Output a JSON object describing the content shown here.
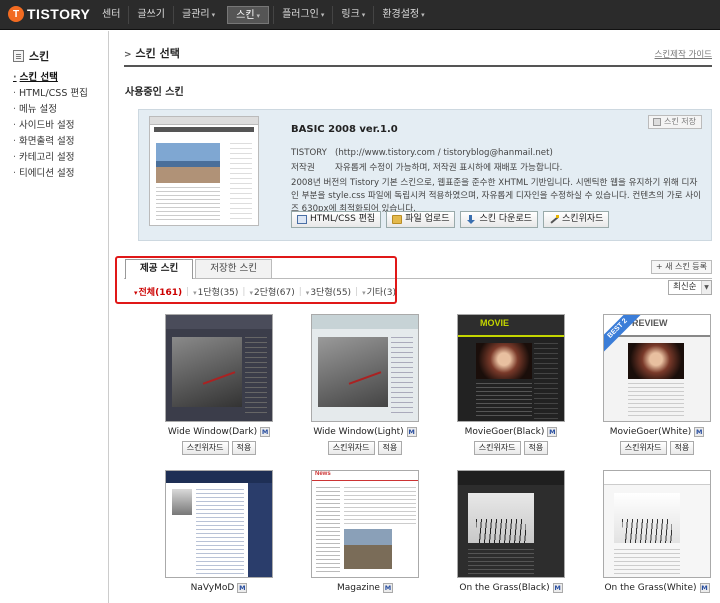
{
  "brand": {
    "logo_mark": "T",
    "logo_text": "TISTORY"
  },
  "nav": {
    "items": [
      {
        "label": "센터"
      },
      {
        "label": "글쓰기"
      },
      {
        "label": "글관리",
        "caret": "▾"
      },
      {
        "label": "스킨",
        "caret": "▾",
        "active": true
      },
      {
        "label": "플러그인",
        "caret": "▾"
      },
      {
        "label": "링크",
        "caret": "▾"
      },
      {
        "label": "환경설정",
        "caret": "▾"
      }
    ]
  },
  "sidebar": {
    "title": "스킨",
    "items": [
      {
        "label": "스킨 선택",
        "active": true
      },
      {
        "label": "HTML/CSS 편집"
      },
      {
        "label": "메뉴 설정"
      },
      {
        "label": "사이드바 설정"
      },
      {
        "label": "화면출력 설정"
      },
      {
        "label": "카테고리 설정"
      },
      {
        "label": "티에디션 설정"
      }
    ]
  },
  "page": {
    "title": "스킨 선택",
    "guide_link": "스킨제작 가이드"
  },
  "current": {
    "section_title": "사용중인 스킨",
    "name": "BASIC 2008 ver.1.0",
    "save_label": "스킨 저장",
    "author_key": "TISTORY",
    "author_val": "(http://www.tistory.com / tistoryblog@hanmail.net)",
    "copyright_key": "저작권",
    "copyright_val": "자유롭게 수정이 가능하며, 저작권 표시하에 재배포 가능합니다.",
    "description": "2008년 버전의 Tistory 기본 스킨으로, 웹표준을 준수한 XHTML 기반입니다. 시멘틱한 웹을 유지하기 위해 디자인 부분을 style.css 파일에 독립시켜 적용하였으며, 자유롭게 디자인을 수정하실 수 있습니다. 컨텐츠의 가로 사이즈 630px에 최적화되어 있습니다.",
    "buttons": {
      "html_css": "HTML/CSS 편집",
      "upload": "파일 업로드",
      "download": "스킨 다운로드",
      "wizard": "스킨위자드"
    }
  },
  "tabs": {
    "provided": "제공 스킨",
    "saved": "저장한 스킨"
  },
  "filters": [
    {
      "label": "전체(161)",
      "active": true
    },
    {
      "label": "1단형(35)"
    },
    {
      "label": "2단형(67)"
    },
    {
      "label": "3단형(55)"
    },
    {
      "label": "기타(3)"
    }
  ],
  "new_skin_label": "+ 새 스킨 등록",
  "sort": {
    "selected": "최신순"
  },
  "badge_label": "M",
  "card_buttons": {
    "wizard": "스킨위자드",
    "apply": "적용"
  },
  "skins": [
    {
      "name": "Wide Window(Dark)"
    },
    {
      "name": "Wide Window(Light)"
    },
    {
      "name": "MovieGoer(Black)",
      "header_word": "MOVIE"
    },
    {
      "name": "MovieGoer(White)",
      "header_word": "REVIEW",
      "ribbon": "BEST 2"
    },
    {
      "name": "NaVyMoD"
    },
    {
      "name": "Magazine",
      "header_word": "News"
    },
    {
      "name": "On the Grass(Black)"
    },
    {
      "name": "On the Grass(White)"
    }
  ]
}
